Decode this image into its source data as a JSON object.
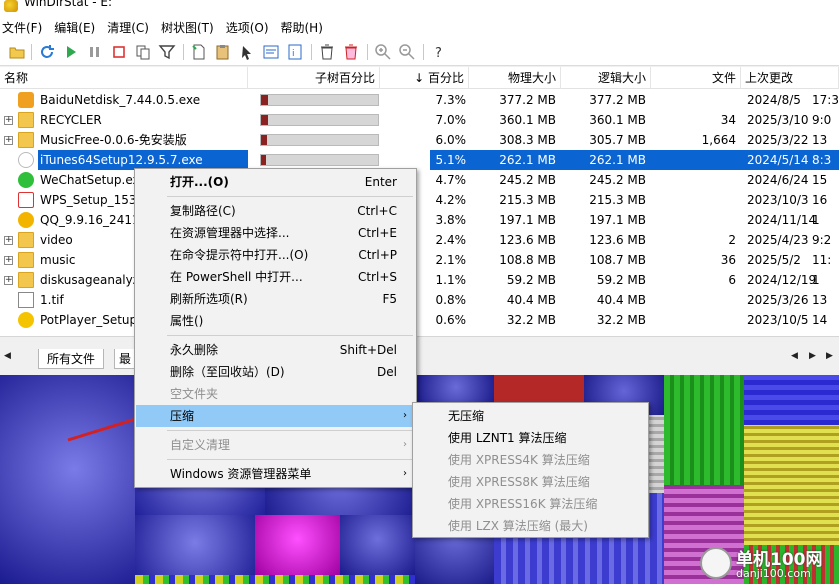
{
  "window": {
    "title": "WinDirStat - E:"
  },
  "menubar": [
    "文件(F)",
    "编辑(E)",
    "清理(C)",
    "树状图(T)",
    "选项(O)",
    "帮助(H)"
  ],
  "columns": {
    "name": "名称",
    "subtree_pct": "子树百分比",
    "pct": "↓ 百分比",
    "physical": "物理大小",
    "logical": "逻辑大小",
    "files": "文件",
    "modified": "上次更改"
  },
  "rows": [
    {
      "name": "BaiduNetdisk_7.44.0.5.exe",
      "bar": 0.073,
      "pct": "7.3%",
      "phys": "377.2 MB",
      "log": "377.2 MB",
      "files": "",
      "date": "2024/8/5",
      "time": "17:3",
      "icon": "baidu-netdisk-icon",
      "expand": false
    },
    {
      "name": "RECYCLER",
      "bar": 0.07,
      "pct": "7.0%",
      "phys": "360.1 MB",
      "log": "360.1 MB",
      "files": "34",
      "date": "2025/3/10",
      "time": "9:0",
      "icon": "folder-icon",
      "expand": true
    },
    {
      "name": "MusicFree-0.0.6-免安装版",
      "bar": 0.06,
      "pct": "6.0%",
      "phys": "308.3 MB",
      "log": "305.7 MB",
      "files": "1,664",
      "date": "2025/3/22",
      "time": "13",
      "icon": "folder-icon",
      "expand": true
    },
    {
      "name": "iTunes64Setup12.9.5.7.exe",
      "bar": 0.051,
      "pct": "5.1%",
      "phys": "262.1 MB",
      "log": "262.1 MB",
      "files": "",
      "date": "2024/5/14",
      "time": "8:3",
      "icon": "itunes-installer-icon",
      "expand": false,
      "selected": true
    },
    {
      "name": "WeChatSetup.exe",
      "bar": 0.047,
      "pct": "4.7%",
      "phys": "245.2 MB",
      "log": "245.2 MB",
      "files": "",
      "date": "2024/6/24",
      "time": "15",
      "icon": "wechat-icon",
      "expand": false
    },
    {
      "name": "WPS_Setup_1537",
      "bar": 0.042,
      "pct": "4.2%",
      "phys": "215.3 MB",
      "log": "215.3 MB",
      "files": "",
      "date": "2023/10/3",
      "time": "16",
      "icon": "wps-icon",
      "expand": false
    },
    {
      "name": "QQ_9.9.16_2411",
      "bar": 0.038,
      "pct": "3.8%",
      "phys": "197.1 MB",
      "log": "197.1 MB",
      "files": "",
      "date": "2024/11/14",
      "time": "1",
      "icon": "qq-icon",
      "expand": false
    },
    {
      "name": "video",
      "bar": 0.024,
      "pct": "2.4%",
      "phys": "123.6 MB",
      "log": "123.6 MB",
      "files": "2",
      "date": "2025/4/23",
      "time": "9:2",
      "icon": "folder-icon",
      "expand": true
    },
    {
      "name": "music",
      "bar": 0.021,
      "pct": "2.1%",
      "phys": "108.8 MB",
      "log": "108.7 MB",
      "files": "36",
      "date": "2025/5/2",
      "time": "11:",
      "icon": "folder-icon",
      "expand": true
    },
    {
      "name": "diskusageanalyz",
      "bar": 0.011,
      "pct": "1.1%",
      "phys": "59.2 MB",
      "log": "59.2 MB",
      "files": "6",
      "date": "2024/12/19",
      "time": "1",
      "icon": "folder-icon",
      "expand": true
    },
    {
      "name": "1.tif",
      "bar": 0.008,
      "pct": "0.8%",
      "phys": "40.4 MB",
      "log": "40.4 MB",
      "files": "",
      "date": "2025/3/26",
      "time": "13",
      "icon": "tif-file-icon",
      "expand": false
    },
    {
      "name": "PotPlayer_Setup_",
      "bar": 0.006,
      "pct": "0.6%",
      "phys": "32.2 MB",
      "log": "32.2 MB",
      "files": "",
      "date": "2023/10/5",
      "time": "14",
      "icon": "potplayer-icon",
      "expand": false
    }
  ],
  "tabs": {
    "all_files": "所有文件",
    "second": "最"
  },
  "context_menu": {
    "items": [
      {
        "label": "打开...(O)",
        "shortcut": "Enter",
        "bold": true
      },
      {
        "sep": true
      },
      {
        "label": "复制路径(C)",
        "shortcut": "Ctrl+C"
      },
      {
        "label": "在资源管理器中选择...",
        "shortcut": "Ctrl+E"
      },
      {
        "label": "在命令提示符中打开...(O)",
        "shortcut": "Ctrl+P"
      },
      {
        "label": "在 PowerShell 中打开...",
        "shortcut": "Ctrl+S"
      },
      {
        "label": "刷新所选项(R)",
        "shortcut": "F5"
      },
      {
        "label": "属性()",
        "shortcut": ""
      },
      {
        "sep": true
      },
      {
        "label": "永久删除",
        "shortcut": "Shift+Del"
      },
      {
        "label": "删除（至回收站）(D)",
        "shortcut": "Del"
      },
      {
        "label": "空文件夹",
        "shortcut": "",
        "disabled": true
      },
      {
        "label": "压缩",
        "shortcut": "",
        "submenu": true,
        "highlight": true
      },
      {
        "sep": true
      },
      {
        "label": "自定义清理",
        "shortcut": "",
        "submenu": true,
        "disabled": true
      },
      {
        "sep": true
      },
      {
        "label": "Windows 资源管理器菜单",
        "shortcut": "",
        "submenu": true
      }
    ]
  },
  "compress_submenu": {
    "items": [
      {
        "label": "无压缩",
        "disabled": false
      },
      {
        "label": "使用 LZNT1 算法压缩",
        "disabled": false
      },
      {
        "label": "使用 XPRESS4K 算法压缩",
        "disabled": true
      },
      {
        "label": "使用 XPRESS8K 算法压缩",
        "disabled": true
      },
      {
        "label": "使用 XPRESS16K 算法压缩",
        "disabled": true
      },
      {
        "label": "使用 LZX 算法压缩 (最大)",
        "disabled": true
      }
    ]
  },
  "watermark": {
    "line1": "单机100网",
    "line2": "danji100.com"
  },
  "colors": {
    "selection": "#0a64d2",
    "menu_highlight": "#91c9f7",
    "bar_fill": "#8a2222",
    "arrow": "#d42020"
  }
}
